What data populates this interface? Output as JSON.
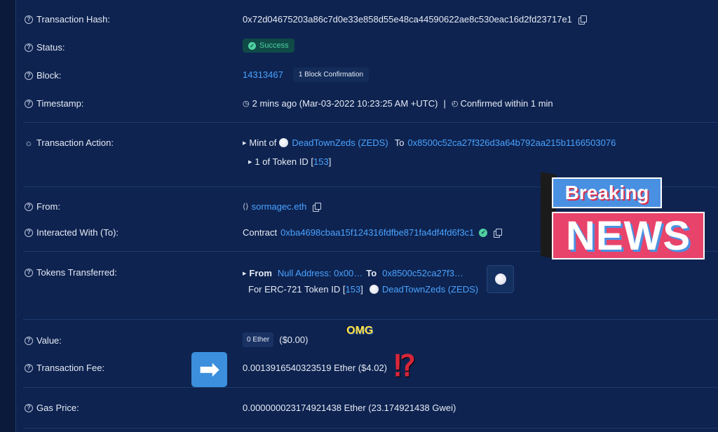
{
  "rows": {
    "tx_hash": {
      "label": "Transaction Hash:",
      "value": "0x72d04675203a86c7d0e33e858d55e48ca44590622ae8c530eac16d2fd23717e1"
    },
    "status": {
      "label": "Status:",
      "value": "Success"
    },
    "block": {
      "label": "Block:",
      "number": "14313467",
      "confirmation": "1 Block Confirmation"
    },
    "timestamp": {
      "label": "Timestamp:",
      "value": "2 mins ago (Mar-03-2022 10:23:25 AM +UTC)",
      "separator": "|",
      "confirmed": "Confirmed within 1 min"
    },
    "tx_action": {
      "label": "Transaction Action:",
      "mint_prefix": "Mint of",
      "token_name": "DeadTownZeds (ZEDS)",
      "to_label": "To",
      "to_address": "0x8500c52ca27f326d3a64b792aa215b1166503076",
      "token_line_prefix": "1 of Token ID [",
      "token_id": "153",
      "token_line_suffix": "]"
    },
    "from": {
      "label": "From:",
      "value": "sormagec.eth"
    },
    "interacted": {
      "label": "Interacted With (To):",
      "prefix": "Contract",
      "address": "0xba4698cbaa15f124316fdfbe871fa4df4fd6f3c1"
    },
    "tokens_transferred": {
      "label": "Tokens Transferred:",
      "from_label": "From",
      "from_value": "Null Address: 0x00…",
      "to_label": "To",
      "to_value": "0x8500c52ca27f3…",
      "line2_prefix": "For ERC-721 Token ID [",
      "token_id": "153",
      "line2_suffix": "]",
      "token_name": "DeadTownZeds (ZEDS)"
    },
    "value": {
      "label": "Value:",
      "amount": "0 Ether",
      "usd": "($0.00)"
    },
    "fee": {
      "label": "Transaction Fee:",
      "value": "0.0013916540323519 Ether ($4.02)"
    },
    "gas": {
      "label": "Gas Price:",
      "value": "0.000000023174921438 Ether (23.174921438 Gwei)"
    }
  },
  "stickers": {
    "breaking": "Breaking",
    "news": "NEWS",
    "omg": "OMG",
    "interrobang": "⁉",
    "arrow": "➡"
  },
  "colors": {
    "background": "#0e2350",
    "link": "#4aa3ff",
    "success": "#4fd1a0"
  }
}
